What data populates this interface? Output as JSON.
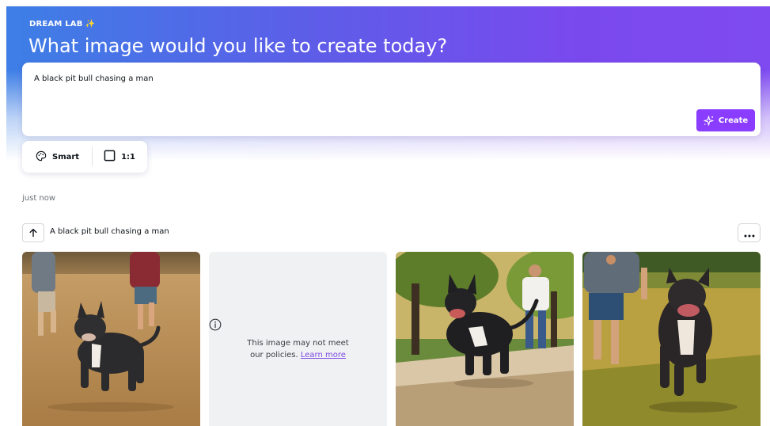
{
  "brand": {
    "name": "DREAM LAB",
    "sparkle_icon": "sparkle-icon",
    "sparkle_glyph": "✨"
  },
  "headline": "What image would you like to create today?",
  "prompt_card": {
    "text": "A black pit bull chasing a man",
    "create_label": "Create",
    "create_icon": "magic-sparkle-icon"
  },
  "options": {
    "style_label": "Smart",
    "style_icon": "palette-icon",
    "ratio_label": "1:1",
    "ratio_icon": "square-icon"
  },
  "timestamp": "just now",
  "result": {
    "prompt": "A black pit bull chasing a man",
    "reuse_icon": "arrow-up-icon",
    "more_icon": "more-horizontal-icon",
    "images": [
      {
        "description": "pit bull running on dry grass with men behind",
        "status": "generated"
      },
      {
        "status": "blocked",
        "message": "This image may not meet our policies.",
        "link": "Learn more"
      },
      {
        "description": "pit bull running on park path, man in white shirt behind",
        "status": "generated"
      },
      {
        "description": "pit bull running on grass field, man in grey shirt behind",
        "status": "generated"
      }
    ]
  },
  "colors": {
    "accent": "#8b3dff",
    "gradient_start": "#3d7fe6",
    "gradient_end": "#7f4bf0",
    "link": "#7d49e6"
  }
}
